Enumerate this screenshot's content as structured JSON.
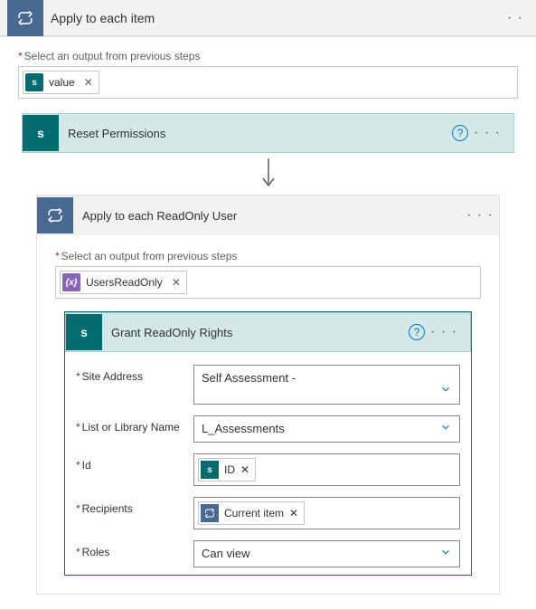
{
  "outerLoop": {
    "title": "Apply to each item",
    "selectLabel": "Select an output from previous steps",
    "token": {
      "label": "value",
      "chipType": "sp"
    }
  },
  "resetAction": {
    "title": "Reset Permissions"
  },
  "innerLoop": {
    "title": "Apply to each ReadOnly User",
    "selectLabel": "Select an output from previous steps",
    "token": {
      "label": "UsersReadOnly",
      "chipType": "expr",
      "chipText": "{x}"
    }
  },
  "grantAction": {
    "title": "Grant ReadOnly Rights",
    "fields": {
      "siteAddress": {
        "label": "Site Address",
        "value": "Self Assessment -"
      },
      "listName": {
        "label": "List or Library Name",
        "value": "L_Assessments"
      },
      "id": {
        "label": "Id",
        "token": {
          "label": "ID",
          "chipType": "sp"
        }
      },
      "recipients": {
        "label": "Recipients",
        "token": {
          "label": "Current item",
          "chipType": "loop"
        }
      },
      "roles": {
        "label": "Roles",
        "value": "Can view"
      }
    }
  },
  "glyphs": {
    "help": "?",
    "close": "✕",
    "spLetter": "s"
  }
}
